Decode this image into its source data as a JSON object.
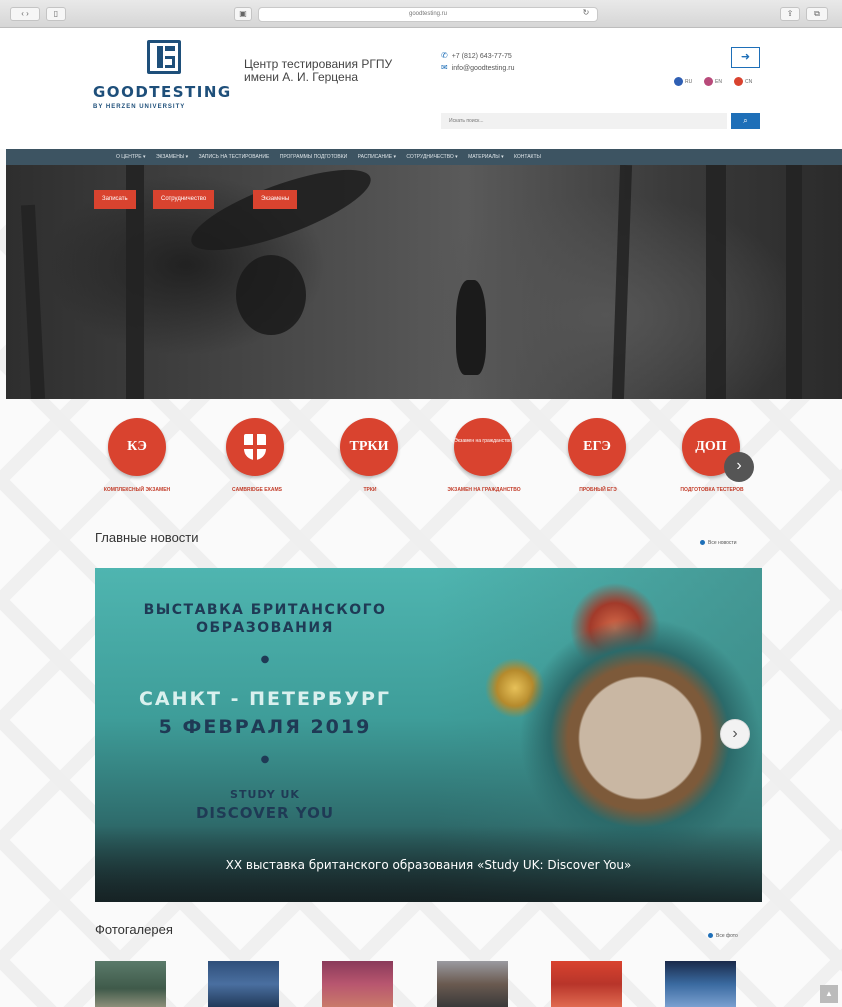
{
  "browser": {
    "url": "goodtesting.ru"
  },
  "header": {
    "logo_name": "GOODTESTING",
    "logo_sub": "BY HERZEN UNIVERSITY",
    "center_title": "Центр тестирования РГПУ имени А. И. Герцена",
    "phone": "+7 (812) 643-77-75",
    "email": "info@goodtesting.ru",
    "login_icon": "login-icon",
    "languages": [
      {
        "code": "RU",
        "color": "#2f5fb3"
      },
      {
        "code": "EN",
        "color": "#b84a7a"
      },
      {
        "code": "CN",
        "color": "#d9432f"
      }
    ],
    "search_placeholder": "Искать поиск...",
    "search_icon": "search-icon"
  },
  "nav": {
    "items": [
      "О ЦЕНТРЕ ▾",
      "ЭКЗАМЕНЫ ▾",
      "ЗАПИСЬ НА ТЕСТИРОВАНИЕ",
      "ПРОГРАММЫ ПОДГОТОВКИ",
      "РАСПИСАНИЕ ▾",
      "СОТРУДНИЧЕСТВО ▾",
      "МАТЕРИАЛЫ ▾",
      "КОНТАКТЫ"
    ]
  },
  "hero": {
    "buttons": [
      "Записать",
      "Сотрудничество",
      "Экзамены"
    ]
  },
  "exams": [
    {
      "badge": "КЭ",
      "label": "КОМПЛЕКСНЫЙ ЭКЗАМЕН"
    },
    {
      "badge": "",
      "label": "CAMBRIDGE EXAMS"
    },
    {
      "badge": "ТРКИ",
      "label": "ТРКИ"
    },
    {
      "badge": "Экзамен на гражданство",
      "label": "ЭКЗАМЕН НА ГРАЖДАНСТВО"
    },
    {
      "badge": "ЕГЭ",
      "label": "ПРОБНЫЙ ЕГЭ"
    },
    {
      "badge": "ДОП",
      "label": "ПОДГОТОВКА ТЕСТЕРОВ"
    }
  ],
  "news": {
    "title": "Главные новости",
    "all_link": "Все новости",
    "slide": {
      "line1": "ВЫСТАВКА БРИТАНСКОГО",
      "line2": "ОБРАЗОВАНИЯ",
      "city": "САНКТ - ПЕТЕРБУРГ",
      "date": "5 ФЕВРАЛЯ 2019",
      "study": "STUDY UK",
      "discover": "DISCOVER YOU",
      "caption": "XX выставка британского образования «Study UK: Discover You»"
    }
  },
  "gallery": {
    "title": "Фотогалерея",
    "all_link": "Все фото"
  },
  "colors": {
    "accent": "#d9432f",
    "brand": "#1e4f7a",
    "nav": "#3d5462",
    "link": "#1e6fb8"
  }
}
